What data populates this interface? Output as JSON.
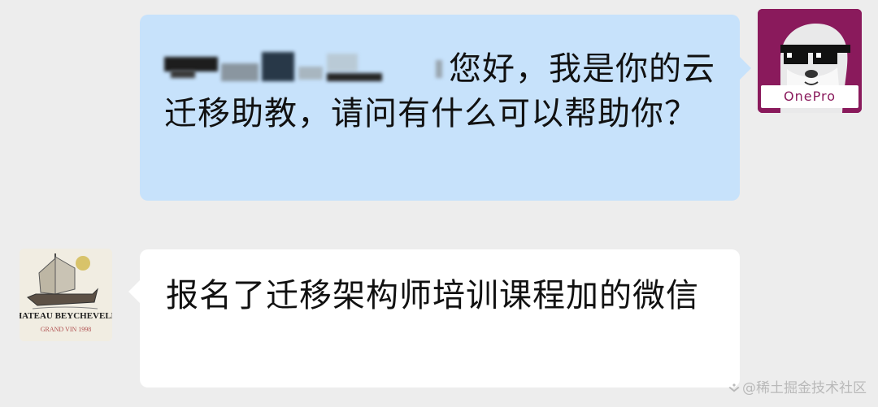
{
  "messages": [
    {
      "direction": "outgoing",
      "text_after_redaction": "您好，我是你的云迁移助教，请问有什么可以帮助你？",
      "avatar": {
        "icon": "onepro-seal-avatar-icon",
        "brand_text": "OnePro",
        "bg_color": "#8a1a5c"
      }
    },
    {
      "direction": "incoming",
      "text": "报名了迁移架构师培训课程加的微信",
      "avatar": {
        "icon": "wine-label-avatar-icon",
        "label_text": "CHATEAU BEYCHEVELLE",
        "sub_text": "GRAND VIN 1998"
      }
    }
  ],
  "colors": {
    "background": "#ededed",
    "outgoing_bubble": "#c7e2fb",
    "incoming_bubble": "#ffffff"
  },
  "watermark": {
    "icon": "juejin-logo-icon",
    "text": "@稀土掘金技术社区"
  }
}
